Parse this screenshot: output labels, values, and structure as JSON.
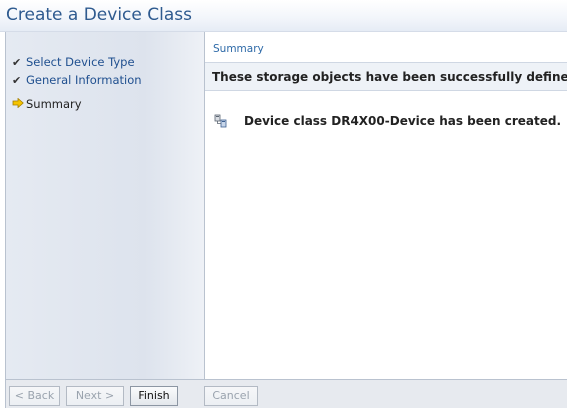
{
  "window": {
    "title": "Create a Device Class"
  },
  "steps": [
    {
      "label": "Select Device Type",
      "status": "done",
      "icon": "checkmark-icon"
    },
    {
      "label": "General Information",
      "status": "done",
      "icon": "checkmark-icon"
    },
    {
      "label": "Summary",
      "status": "current",
      "icon": "arrow-right-icon"
    }
  ],
  "main": {
    "breadcrumb": "Summary",
    "header_message": "These storage objects have been successfully defined.",
    "result_icon": "device-class-icon",
    "result_text": "Device class DR4X00-Device has been created."
  },
  "buttons": {
    "back": "< Back",
    "next": "Next >",
    "finish": "Finish",
    "cancel": "Cancel"
  },
  "colors": {
    "title": "#2e5a8f",
    "link": "#1f4f8f",
    "arrow": "#f5c400"
  }
}
